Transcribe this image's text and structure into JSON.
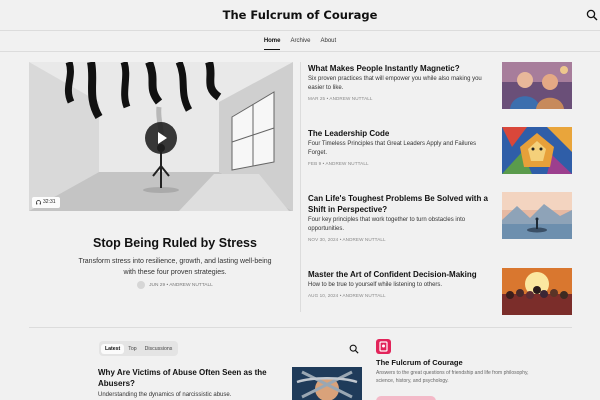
{
  "header": {
    "site_title": "The Fulcrum of Courage",
    "search_icon": "search-icon"
  },
  "nav": {
    "items": [
      "Home",
      "Archive",
      "About"
    ],
    "active": "Home"
  },
  "hero": {
    "duration": "32:31",
    "title": "Stop Being Ruled by Stress",
    "subtitle": "Transform stress into resilience, growth, and lasting well-being with these four proven strategies.",
    "meta": "JUN 29 • ANDREW NUTTALL"
  },
  "posts": [
    {
      "title": "What Makes People Instantly Magnetic?",
      "desc": "Six proven practices that will empower you while also making you easier to like.",
      "meta": "MAR 25 • ANDREW NUTTALL"
    },
    {
      "title": "The Leadership Code",
      "desc": "Four Timeless Principles that Great Leaders Apply and Failures Forget.",
      "meta": "FEB 9 • ANDREW NUTTALL"
    },
    {
      "title": "Can Life's Toughest Problems Be Solved with a Shift in Perspective?",
      "desc": "Four key principles that work together to turn obstacles into opportunities.",
      "meta": "NOV 30, 2024 • ANDREW NUTTALL"
    },
    {
      "title": "Master the Art of Confident Decision-Making",
      "desc": "How to be true to yourself while listening to others.",
      "meta": "AUG 10, 2024 • ANDREW NUTTALL"
    }
  ],
  "feed": {
    "tabs": [
      "Latest",
      "Top",
      "Discussions"
    ],
    "active_tab": "Latest",
    "post": {
      "title": "Why Are Victims of Abuse Often Seen as the Abusers?",
      "desc": "Understanding the dynamics of narcissistic abuse."
    }
  },
  "publication": {
    "name": "The Fulcrum of Courage",
    "description": "Answers to the great questions of friendship and life from philosophy, science, history, and psychology.",
    "accent": "#e2245a"
  }
}
